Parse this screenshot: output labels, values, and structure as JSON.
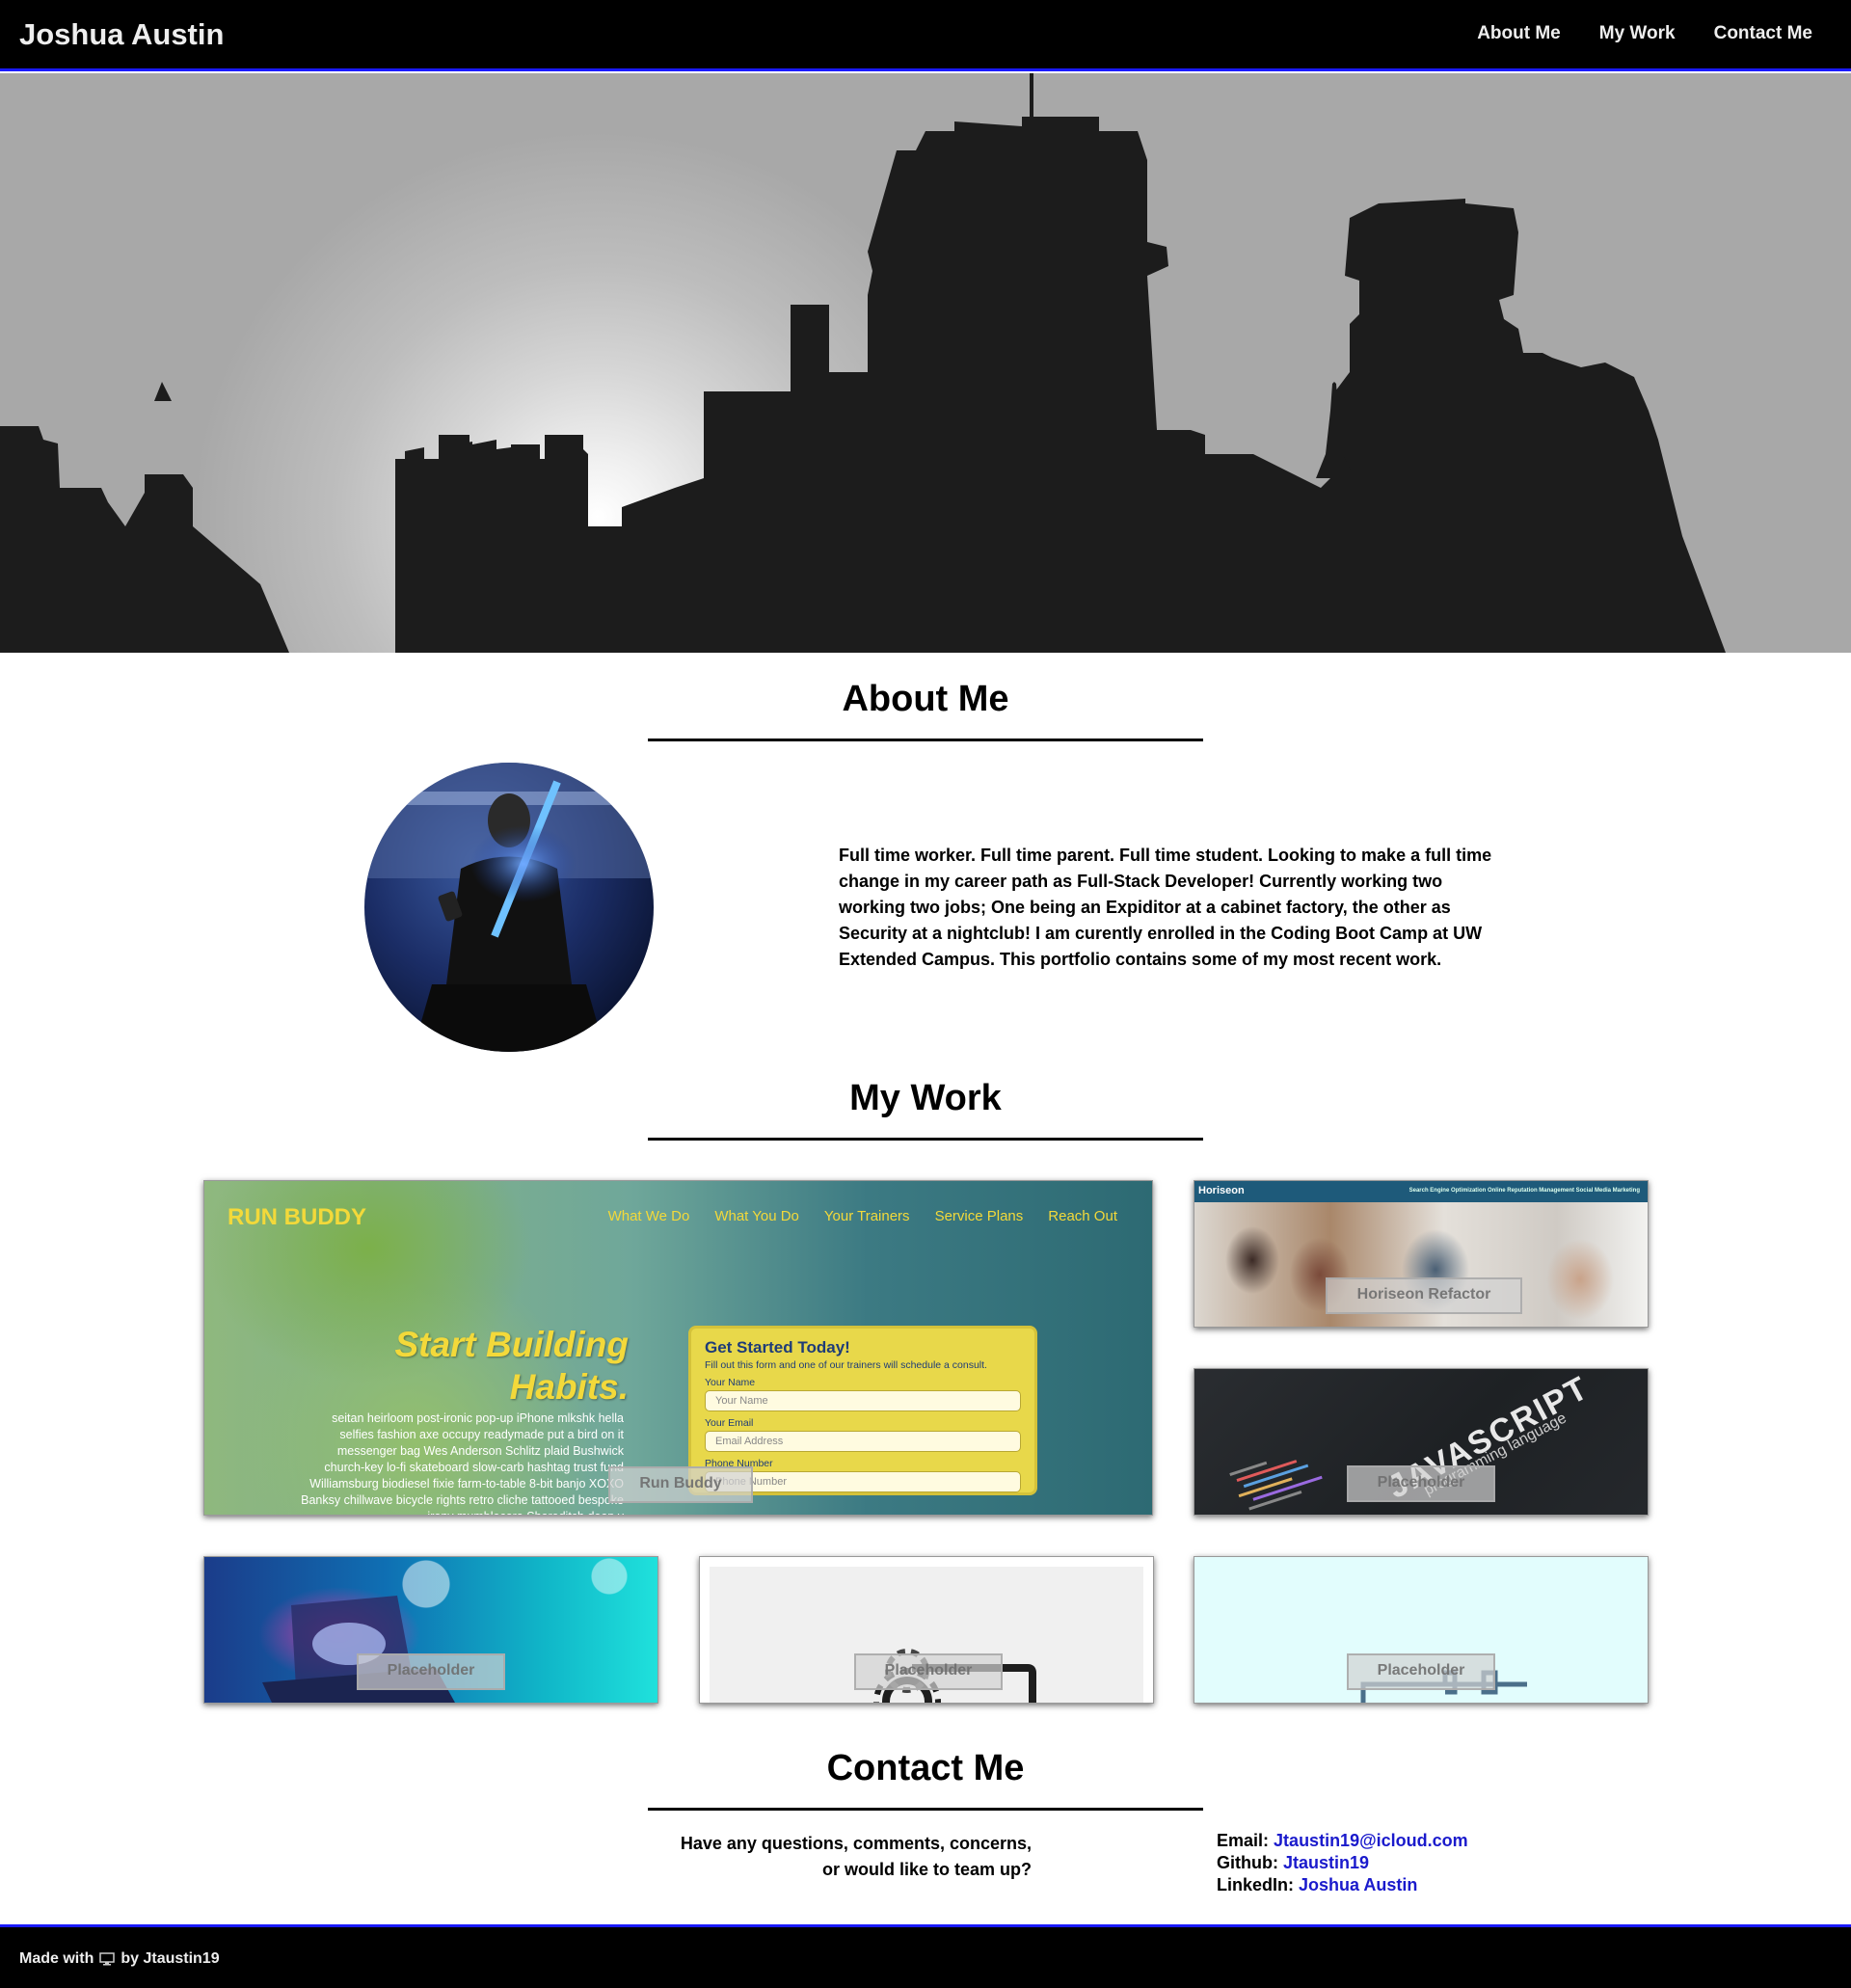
{
  "header": {
    "brand": "Joshua Austin",
    "nav": [
      "About Me",
      "My Work",
      "Contact Me"
    ]
  },
  "about": {
    "title": "About Me",
    "bio": "Full time worker. Full time parent. Full time student. Looking to make a full time change in my career path as Full-Stack Developer! Currently working two working two jobs; One being an Expiditor at a cabinet factory, the other as Security at a nightclub! I am curently enrolled in the Coding Boot Camp at UW Extended Campus. This portfolio contains some of my most recent work."
  },
  "work": {
    "title": "My Work",
    "projects": [
      {
        "label": "Run Buddy"
      },
      {
        "label": "Horiseon Refactor"
      },
      {
        "label": "Placeholder"
      },
      {
        "label": "Placeholder"
      },
      {
        "label": "Placeholder"
      },
      {
        "label": "Placeholder"
      }
    ],
    "run_buddy_preview": {
      "logo": "RUN BUDDY",
      "nav": [
        "What We Do",
        "What You Do",
        "Your Trainers",
        "Service Plans",
        "Reach Out"
      ],
      "headline_1": "Start Building",
      "headline_2": "Habits.",
      "lorem": "seitan heirloom post-ironic pop-up iPhone mlkshk hella selfies fashion axe occupy readymade put a bird on it messenger bag Wes Anderson Schlitz plaid Bushwick church-key lo-fi skateboard slow-carb hashtag trust fund Williamsburg biodiesel fixie farm-to-table 8-bit banjo XOXO Banksy chillwave bicycle rights retro cliche tattooed bespoke irony mumblecore Shoreditch deep v",
      "form_title": "Get Started Today!",
      "form_sub": "Fill out this form and one of our trainers will schedule a consult.",
      "name_label": "Your Name",
      "name_placeholder": "Your Name",
      "email_label": "Your Email",
      "email_placeholder": "Email Address",
      "phone_label": "Phone Number",
      "phone_placeholder": "Phone Number"
    },
    "horiseon_preview": {
      "brand": "Horiseon",
      "nav": "Search Engine Optimization   Online Reputation Management   Social Media Marketing"
    },
    "js_preview": {
      "word": "JAVASCRIPT",
      "sub": "programming language"
    }
  },
  "contact": {
    "title": "Contact Me",
    "prompt_line1": "Have any questions, comments, concerns,",
    "prompt_line2": "or would like to team up?",
    "email_label": "Email:",
    "email": "Jtaustin19@icloud.com",
    "github_label": "Github:",
    "github": "Jtaustin19",
    "linkedin_label": "LinkedIn:",
    "linkedin": "Joshua Austin"
  },
  "footer": {
    "made_with": "Made with",
    "by": "by Jtaustin19"
  },
  "colors": {
    "accent_blue": "#1a1aff",
    "link_blue": "#1a1acc",
    "header_bg": "#000000"
  }
}
